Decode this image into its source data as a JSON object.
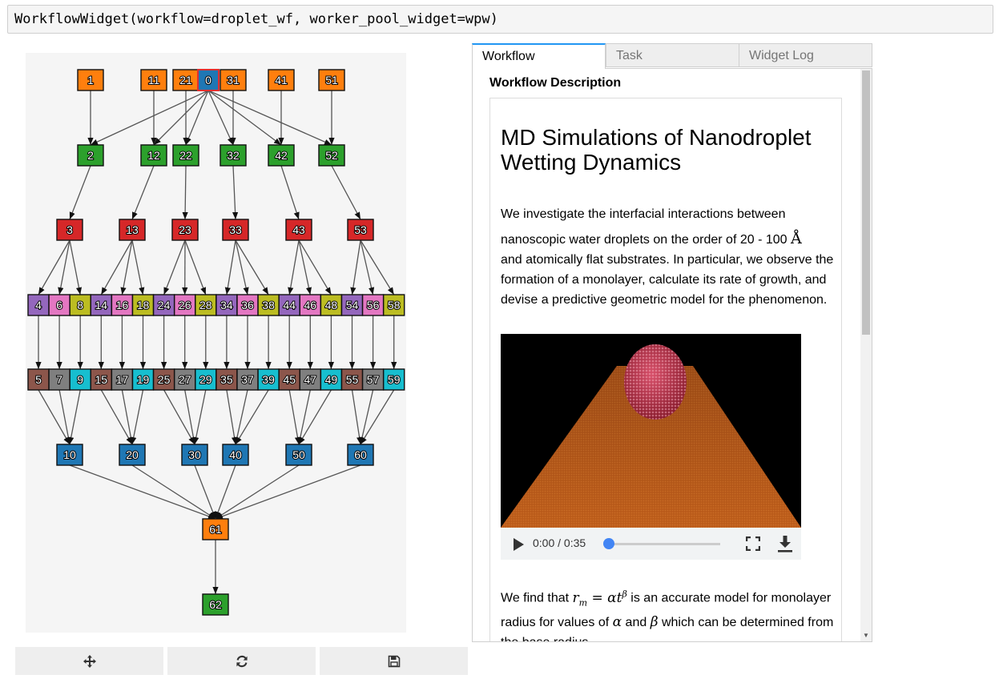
{
  "code_cell": {
    "text": "WorkflowWidget(workflow=droplet_wf, worker_pool_widget=wpw)"
  },
  "graph": {
    "nodes": [
      {
        "id": "1",
        "color": "#ff7f0e"
      },
      {
        "id": "11",
        "color": "#ff7f0e"
      },
      {
        "id": "21",
        "color": "#ff7f0e"
      },
      {
        "id": "0",
        "color": "#1f77b4"
      },
      {
        "id": "31",
        "color": "#ff7f0e"
      },
      {
        "id": "41",
        "color": "#ff7f0e"
      },
      {
        "id": "51",
        "color": "#ff7f0e"
      },
      {
        "id": "2",
        "color": "#2ca02c"
      },
      {
        "id": "12",
        "color": "#2ca02c"
      },
      {
        "id": "22",
        "color": "#2ca02c"
      },
      {
        "id": "32",
        "color": "#2ca02c"
      },
      {
        "id": "42",
        "color": "#2ca02c"
      },
      {
        "id": "52",
        "color": "#2ca02c"
      },
      {
        "id": "3",
        "color": "#d62728"
      },
      {
        "id": "13",
        "color": "#d62728"
      },
      {
        "id": "23",
        "color": "#d62728"
      },
      {
        "id": "33",
        "color": "#d62728"
      },
      {
        "id": "43",
        "color": "#d62728"
      },
      {
        "id": "53",
        "color": "#d62728"
      },
      {
        "id": "4",
        "color": "#9467bd"
      },
      {
        "id": "6",
        "color": "#e377c2"
      },
      {
        "id": "8",
        "color": "#bcbd22"
      },
      {
        "id": "14",
        "color": "#9467bd"
      },
      {
        "id": "16",
        "color": "#e377c2"
      },
      {
        "id": "18",
        "color": "#bcbd22"
      },
      {
        "id": "24",
        "color": "#9467bd"
      },
      {
        "id": "26",
        "color": "#e377c2"
      },
      {
        "id": "28",
        "color": "#bcbd22"
      },
      {
        "id": "34",
        "color": "#9467bd"
      },
      {
        "id": "36",
        "color": "#e377c2"
      },
      {
        "id": "38",
        "color": "#bcbd22"
      },
      {
        "id": "44",
        "color": "#9467bd"
      },
      {
        "id": "46",
        "color": "#e377c2"
      },
      {
        "id": "48",
        "color": "#bcbd22"
      },
      {
        "id": "54",
        "color": "#9467bd"
      },
      {
        "id": "56",
        "color": "#e377c2"
      },
      {
        "id": "58",
        "color": "#bcbd22"
      },
      {
        "id": "5",
        "color": "#8c564b"
      },
      {
        "id": "7",
        "color": "#7f7f7f"
      },
      {
        "id": "9",
        "color": "#17becf"
      },
      {
        "id": "15",
        "color": "#8c564b"
      },
      {
        "id": "17",
        "color": "#7f7f7f"
      },
      {
        "id": "19",
        "color": "#17becf"
      },
      {
        "id": "25",
        "color": "#8c564b"
      },
      {
        "id": "27",
        "color": "#7f7f7f"
      },
      {
        "id": "29",
        "color": "#17becf"
      },
      {
        "id": "35",
        "color": "#8c564b"
      },
      {
        "id": "37",
        "color": "#7f7f7f"
      },
      {
        "id": "39",
        "color": "#17becf"
      },
      {
        "id": "45",
        "color": "#8c564b"
      },
      {
        "id": "47",
        "color": "#7f7f7f"
      },
      {
        "id": "49",
        "color": "#17becf"
      },
      {
        "id": "55",
        "color": "#8c564b"
      },
      {
        "id": "57",
        "color": "#7f7f7f"
      },
      {
        "id": "59",
        "color": "#17becf"
      },
      {
        "id": "10",
        "color": "#1f77b4"
      },
      {
        "id": "20",
        "color": "#1f77b4"
      },
      {
        "id": "30",
        "color": "#1f77b4"
      },
      {
        "id": "40",
        "color": "#1f77b4"
      },
      {
        "id": "50",
        "color": "#1f77b4"
      },
      {
        "id": "60",
        "color": "#1f77b4"
      },
      {
        "id": "61",
        "color": "#ff7f0e"
      },
      {
        "id": "62",
        "color": "#2ca02c"
      }
    ],
    "edges": [
      [
        "1",
        "2"
      ],
      [
        "11",
        "12"
      ],
      [
        "51",
        "52"
      ],
      [
        "0",
        "2"
      ],
      [
        "0",
        "12"
      ],
      [
        "0",
        "22"
      ],
      [
        "0",
        "32"
      ],
      [
        "0",
        "42"
      ],
      [
        "0",
        "52"
      ],
      [
        "21",
        "22"
      ],
      [
        "31",
        "32"
      ],
      [
        "41",
        "42"
      ],
      [
        "2",
        "3"
      ],
      [
        "12",
        "13"
      ],
      [
        "22",
        "23"
      ],
      [
        "32",
        "33"
      ],
      [
        "42",
        "43"
      ],
      [
        "52",
        "53"
      ],
      [
        "3",
        "4"
      ],
      [
        "3",
        "6"
      ],
      [
        "3",
        "8"
      ],
      [
        "13",
        "14"
      ],
      [
        "13",
        "16"
      ],
      [
        "13",
        "18"
      ],
      [
        "23",
        "24"
      ],
      [
        "23",
        "26"
      ],
      [
        "23",
        "28"
      ],
      [
        "33",
        "34"
      ],
      [
        "33",
        "36"
      ],
      [
        "33",
        "38"
      ],
      [
        "43",
        "44"
      ],
      [
        "43",
        "46"
      ],
      [
        "43",
        "48"
      ],
      [
        "53",
        "54"
      ],
      [
        "53",
        "56"
      ],
      [
        "53",
        "58"
      ],
      [
        "4",
        "5"
      ],
      [
        "6",
        "7"
      ],
      [
        "8",
        "9"
      ],
      [
        "14",
        "15"
      ],
      [
        "16",
        "17"
      ],
      [
        "18",
        "19"
      ],
      [
        "24",
        "25"
      ],
      [
        "26",
        "27"
      ],
      [
        "28",
        "29"
      ],
      [
        "34",
        "35"
      ],
      [
        "36",
        "37"
      ],
      [
        "38",
        "39"
      ],
      [
        "44",
        "45"
      ],
      [
        "46",
        "47"
      ],
      [
        "48",
        "49"
      ],
      [
        "54",
        "55"
      ],
      [
        "56",
        "57"
      ],
      [
        "58",
        "59"
      ],
      [
        "5",
        "10"
      ],
      [
        "7",
        "10"
      ],
      [
        "9",
        "10"
      ],
      [
        "15",
        "20"
      ],
      [
        "17",
        "20"
      ],
      [
        "19",
        "20"
      ],
      [
        "25",
        "30"
      ],
      [
        "27",
        "30"
      ],
      [
        "29",
        "30"
      ],
      [
        "35",
        "40"
      ],
      [
        "37",
        "40"
      ],
      [
        "39",
        "40"
      ],
      [
        "45",
        "50"
      ],
      [
        "47",
        "50"
      ],
      [
        "49",
        "50"
      ],
      [
        "55",
        "60"
      ],
      [
        "57",
        "60"
      ],
      [
        "59",
        "60"
      ],
      [
        "10",
        "61"
      ],
      [
        "20",
        "61"
      ],
      [
        "30",
        "61"
      ],
      [
        "40",
        "61"
      ],
      [
        "50",
        "61"
      ],
      [
        "60",
        "61"
      ],
      [
        "61",
        "62"
      ]
    ]
  },
  "toolbar": {
    "buttons": [
      {
        "icon": "move-icon"
      },
      {
        "icon": "refresh-icon"
      },
      {
        "icon": "save-icon"
      }
    ]
  },
  "tabs": [
    {
      "label": "Workflow",
      "active": true
    },
    {
      "label": "Task",
      "active": false
    },
    {
      "label": "Widget Log",
      "active": false
    }
  ],
  "description": {
    "heading": "Workflow Description",
    "title": "MD Simulations of Nanodroplet Wetting Dynamics",
    "para1": {
      "line1": "We investigate the interfacial interactions between",
      "line2": "nanoscopic water droplets on the order of 20 - 100",
      "unit": "Å",
      "rest": "and atomically flat substrates. In particular, we observe the formation of a monolayer, calculate its rate of growth, and devise a predictive geometric model for the phenomenon."
    },
    "video": {
      "time": "0:00 / 0:35",
      "progress": 0.0
    },
    "para2": {
      "t1": "We find that ",
      "eq_r": "r",
      "eq_sub": "m",
      "eq_mid": " = αt",
      "eq_sup": "β",
      "t2": " is an accurate model for monolayer radius for values of ",
      "alpha": "α",
      "t3": " and ",
      "beta": "β",
      "t4": " which can be determined from the base radius."
    }
  },
  "colors": {
    "accent": "#2196f3",
    "slider": "#4285f4",
    "substrate": "#b85a14",
    "droplet": "#c83048"
  }
}
